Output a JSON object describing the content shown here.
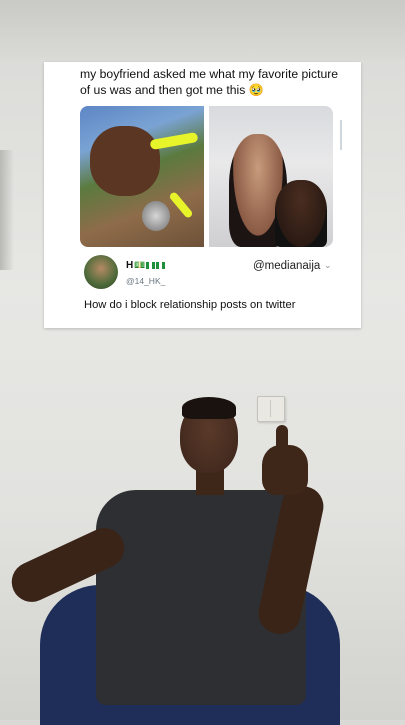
{
  "post": {
    "caption": "my boyfriend asked me what my favorite picture of us was and then got me this 🥹",
    "user": {
      "name": "H",
      "name_emoji": "💵",
      "flags": 2,
      "handle": "@14_HK_",
      "avatar_icon": "profile-avatar"
    },
    "watermark": "@medianaija",
    "menu_icon": "chevron-down-icon",
    "reply_text": "How do i block relationship posts on twitter"
  },
  "colors": {
    "card_bg": "#ffffff",
    "nail_color": "#e8f42a",
    "handle_gray": "#6a7680"
  }
}
